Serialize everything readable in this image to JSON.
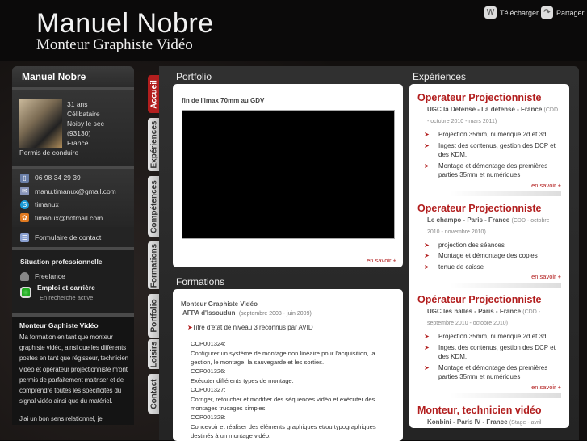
{
  "header": {
    "title": "Manuel Nobre",
    "subtitle": "Monteur Graphiste Vidéo",
    "download": "Télécharger",
    "share": "Partager"
  },
  "sidebar": {
    "name": "Manuel Nobre",
    "info": [
      "31 ans",
      "Célibataire",
      "Noisy le sec",
      "(93130)",
      "France",
      "Permis de conduire"
    ],
    "contacts": [
      {
        "icon": "phone-icon",
        "text": "06 98 34 29 39",
        "color": "#6a7fa8"
      },
      {
        "icon": "mail-icon",
        "text": "manu.timanux@gmail.com",
        "color": "#8894b8"
      },
      {
        "icon": "skype-icon",
        "text": "timanux",
        "color": "#1a9ad6"
      },
      {
        "icon": "msn-icon",
        "text": "timanux@hotmail.com",
        "color": "#e07a20"
      }
    ],
    "contact_form": "Formulaire de contact",
    "situation_title": "Situation professionnelle",
    "freelance": "Freelance",
    "emploi": "Emploi et carrière",
    "emploi_status": "En recherche active",
    "profile_title": "Monteur Gaphiste Vidéo",
    "profile_text": "Ma formation en tant que monteur graphiste vidéo, ainsi que les différents postes en tant que régisseur, technicien vidéo et opérateur projectionniste m'ont permis de parfaitement maitriser et de comprendre toutes les spécificités du signal vidéo ainsi que du matériel.",
    "profile_text2": "J'ai un bon sens relationnel, je"
  },
  "tabs": [
    "Accueil",
    "Expériences",
    "Compétences",
    "Formations",
    "Portfolio",
    "Loisirs",
    "Contact"
  ],
  "portfolio": {
    "title": "Portfolio",
    "video_title": "fin de l'imax 70mm au GDV",
    "more": "en savoir +"
  },
  "formations": {
    "title": "Formations",
    "degree": "Monteur Graphiste Vidéo",
    "school": "AFPA d'Issoudun",
    "dates": "(septembre 2008 - juin 2009)",
    "bullet": "Titre d'état de niveau 3 reconnus par AVID",
    "lines": [
      "CCP001324:",
      "Configurer un système de montage non linéaire pour l'acquisition, la gestion, le montage, la sauvegarde et les sorties.",
      "CCP001326:",
      "Exécuter différents types de montage.",
      "CCP001327:",
      "Corriger, retoucher et modifier des séquences vidéo et exécuter des montages trucages simples.",
      "CCP001328:",
      "Concevoir et réaliser des éléments graphiques et/ou typographiques destinés à un montage vidéo."
    ]
  },
  "experiences": {
    "title": "Expériences",
    "more": "en savoir +",
    "jobs": [
      {
        "title": "Operateur Projectionniste",
        "place": "UGC la Defense - La defense - France",
        "period": "(CDD - octobre 2010 - mars 2011)",
        "bullets": [
          "Projection 35mm, numérique 2d et 3d",
          "Ingest des contenus, gestion des DCP et des KDM,",
          "Montage et démontage des premières parties 35mm et numériques"
        ]
      },
      {
        "title": "Operateur Projectionniste",
        "place": "Le champo - Paris - France",
        "period": "(CDD - octobre 2010 - novembre 2010)",
        "bullets": [
          "projection des séances",
          "Montage et démontage des copies",
          "tenue de caisse"
        ]
      },
      {
        "title": "Opérateur Projectionniste",
        "place": "UGC les halles - Paris - France",
        "period": "(CDD - septembre 2010 - octobre 2010)",
        "bullets": [
          "Projection 35mm, numérique 2d et 3d",
          "Ingest des contenus, gestion des DCP et des KDM,",
          "Montage et démontage des premières parties 35mm et numériques"
        ]
      },
      {
        "title": "Monteur, technicien vidéo",
        "place": "Konbini - Paris IV - France",
        "period": "(Stage - avril",
        "bullets": []
      }
    ]
  },
  "colors": {
    "accent": "#b21e1e"
  }
}
